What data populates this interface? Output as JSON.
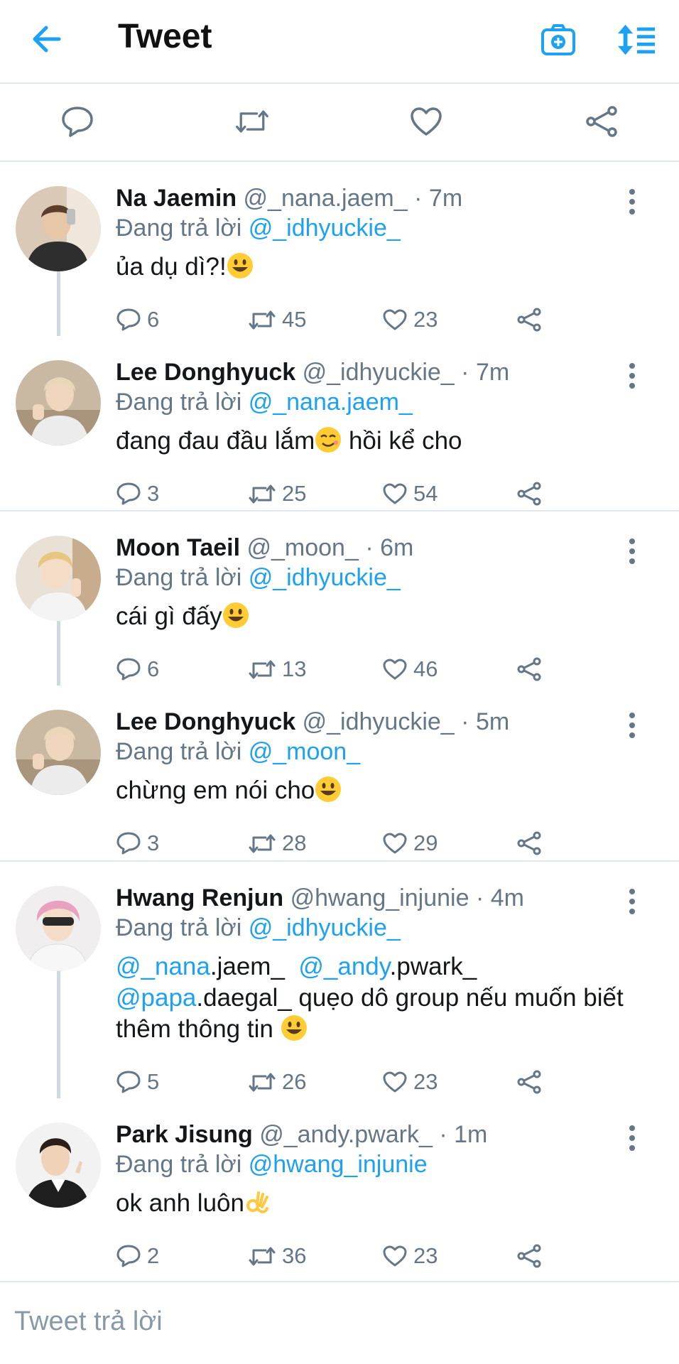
{
  "header": {
    "title": "Tweet",
    "back_icon": "arrow-left-icon",
    "camera_icon": "camera-plus-icon",
    "sort_icon": "sort-list-icon",
    "accent": "#1da1f2"
  },
  "action_bar": {
    "icons": [
      "reply-icon",
      "retweet-icon",
      "like-icon",
      "share-icon"
    ]
  },
  "tweets": [
    {
      "name": "Na Jaemin",
      "handle": "@_nana.jaem_",
      "time": "7m",
      "reply_prefix": "Đang trả lời",
      "reply_to": "@_idhyuckie_",
      "text": "ủa dụ dì?!",
      "emoji": "grinning-face",
      "replies": "6",
      "retweets": "45",
      "likes": "23"
    },
    {
      "name": "Lee Donghyuck",
      "handle": "@_idhyuckie_",
      "time": "7m",
      "reply_prefix": "Đang trả lời",
      "reply_to": "@_nana.jaem_",
      "text_before": "đang đau đầu lắm",
      "text_after": " hồi kể cho",
      "emoji": "smiling-face",
      "replies": "3",
      "retweets": "25",
      "likes": "54"
    },
    {
      "name": "Moon Taeil",
      "handle": "@_moon_",
      "time": "6m",
      "reply_prefix": "Đang trả lời",
      "reply_to": "@_idhyuckie_",
      "text": "cái gì đấy",
      "emoji": "grinning-face",
      "replies": "6",
      "retweets": "13",
      "likes": "46"
    },
    {
      "name": "Lee Donghyuck",
      "handle": "@_idhyuckie_",
      "time": "5m",
      "reply_prefix": "Đang trả lời",
      "reply_to": "@_moon_",
      "text": "chừng em nói cho",
      "emoji": "grinning-face",
      "replies": "3",
      "retweets": "28",
      "likes": "29"
    },
    {
      "name": "Hwang Renjun",
      "handle": "@hwang_injunie",
      "time": "4m",
      "reply_prefix": "Đang trả lời",
      "reply_to": "@_idhyuckie_",
      "m1": "@_nana",
      "m1_rest": ".jaem_",
      "m2": "@_andy",
      "m2_rest": ".pwark_",
      "m3": "@papa",
      "m3_rest": ".daegal_ quẹo dô group nếu muốn biết",
      "line3": "thêm thông tin ",
      "emoji": "grinning-face",
      "replies": "5",
      "retweets": "26",
      "likes": "23"
    },
    {
      "name": "Park Jisung",
      "handle": "@_andy.pwark_",
      "time": "1m",
      "reply_prefix": "Đang trả lời",
      "reply_to": "@hwang_injunie",
      "text": "ok anh luôn",
      "emoji": "ok-hand",
      "replies": "2",
      "retweets": "36",
      "likes": "23"
    }
  ],
  "reply_box": {
    "placeholder": "Tweet trả lời"
  }
}
